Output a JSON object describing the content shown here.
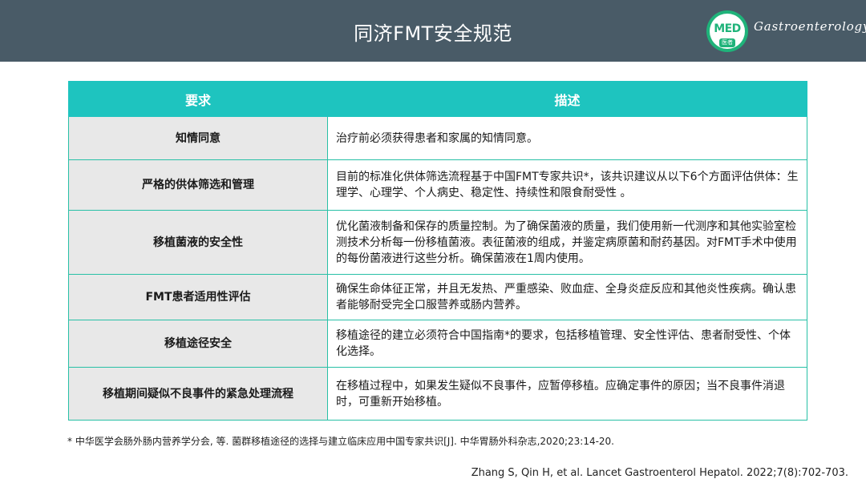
{
  "header": {
    "title": "同济FMT安全规范",
    "logo_text": "MED",
    "logo_sub": "医者",
    "brand": "Gastroenterology"
  },
  "table": {
    "headers": [
      "要求",
      "描述"
    ],
    "rows": [
      {
        "requirement": "知情同意",
        "description": "治疗前必须获得患者和家属的知情同意。"
      },
      {
        "requirement": "严格的供体筛选和管理",
        "description": "目前的标准化供体筛选流程基于中国FMT专家共识*，该共识建议从以下6个方面评估供体：生理学、心理学、个人病史、稳定性、持续性和限食耐受性 。"
      },
      {
        "requirement": "移植菌液的安全性",
        "description": "优化菌液制备和保存的质量控制。为了确保菌液的质量，我们使用新一代测序和其他实验室检测技术分析每一份移植菌液。表征菌液的组成，并鉴定病原菌和耐药基因。对FMT手术中使用的每份菌液进行这些分析。确保菌液在1周内使用。"
      },
      {
        "requirement": "FMT患者适用性评估",
        "description": "确保生命体征正常，并且无发热、严重感染、败血症、全身炎症反应和其他炎性疾病。确认患者能够耐受完全口服营养或肠内营养。"
      },
      {
        "requirement": "移植途径安全",
        "description": "移植途径的建立必须符合中国指南*的要求，包括移植管理、安全性评估、患者耐受性、个体化选择。"
      },
      {
        "requirement": "移植期间疑似不良事件的紧急处理流程",
        "description": "在移植过程中，如果发生疑似不良事件，应暂停移植。应确定事件的原因；当不良事件消退时，可重新开始移植。"
      }
    ]
  },
  "footnote": "* 中华医学会肠外肠内营养学分会, 等. 菌群移植途径的选择与建立临床应用中国专家共识[J]. 中华胃肠外科杂志,2020;23:14-20.",
  "citation": "Zhang S, Qin H, et al. Lancet Gastroenterol Hepatol. 2022;7(8):702-703.",
  "colors": {
    "header_bg": "#495b67",
    "table_header_bg": "#1ec4bf",
    "requirement_cell_bg": "#e8e8e8",
    "border": "#28c0a6",
    "logo_green": "#1fb37a"
  }
}
